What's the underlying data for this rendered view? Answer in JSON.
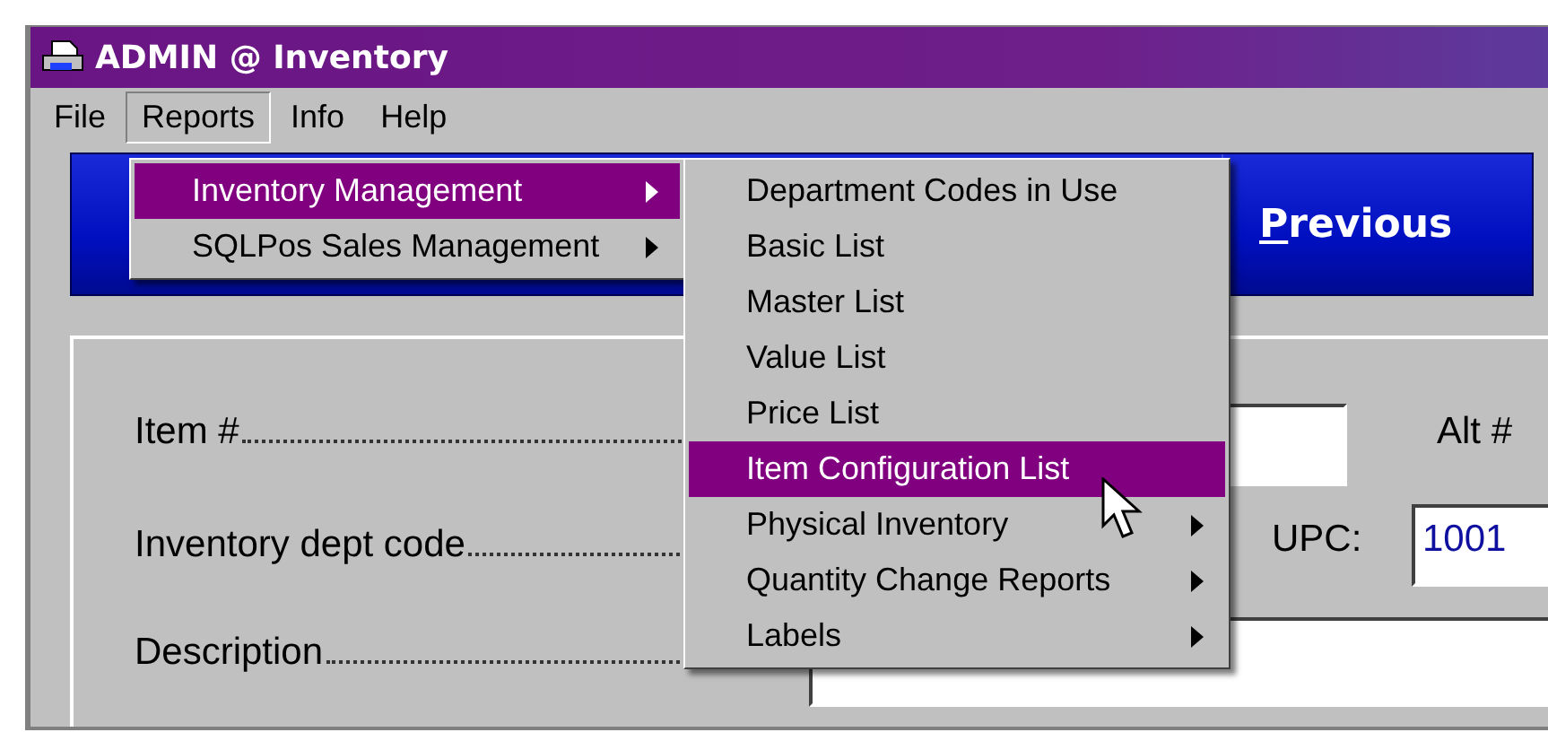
{
  "window": {
    "title": "ADMIN @ Inventory"
  },
  "menu_bar": [
    {
      "label": "File",
      "open": false
    },
    {
      "label": "Reports",
      "open": true
    },
    {
      "label": "Info",
      "open": false
    },
    {
      "label": "Help",
      "open": false
    }
  ],
  "reports_menu": [
    {
      "label": "Inventory Management",
      "selected": true,
      "has_submenu": true
    },
    {
      "label": "SQLPos Sales Management",
      "selected": false,
      "has_submenu": true
    }
  ],
  "inventory_submenu": [
    {
      "label": "Department Codes in Use",
      "selected": false,
      "has_submenu": false
    },
    {
      "label": "Basic List",
      "selected": false,
      "has_submenu": false
    },
    {
      "label": "Master List",
      "selected": false,
      "has_submenu": false
    },
    {
      "label": "Value List",
      "selected": false,
      "has_submenu": false
    },
    {
      "label": "Price List",
      "selected": false,
      "has_submenu": false
    },
    {
      "label": "Item Configuration List",
      "selected": true,
      "has_submenu": false
    },
    {
      "label": "Physical Inventory",
      "selected": false,
      "has_submenu": true
    },
    {
      "label": "Quantity Change Reports",
      "selected": false,
      "has_submenu": true
    },
    {
      "label": "Labels",
      "selected": false,
      "has_submenu": true
    }
  ],
  "toolbar": {
    "previous_button": "Previous"
  },
  "form": {
    "item_number_label": "Item #",
    "alt_label": "Alt #",
    "dept_code_label": "Inventory dept code",
    "upc_label": "UPC:",
    "upc_value": "1001",
    "description_label": "Description"
  }
}
